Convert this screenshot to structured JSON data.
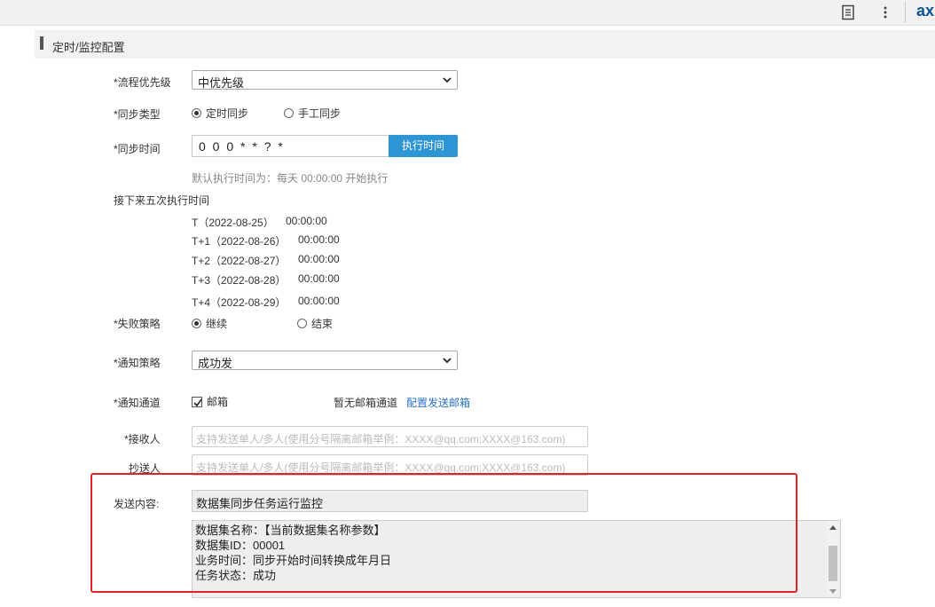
{
  "topbar": {
    "brand": "ax",
    "icons": [
      "document-icon",
      "more-vertical-icon"
    ]
  },
  "section": {
    "title": "定时/监控配置"
  },
  "form": {
    "priority": {
      "label": "*流程优先级",
      "value": "中优先级"
    },
    "sync_type": {
      "label": "*同步类型",
      "options": [
        "定时同步",
        "手工同步"
      ],
      "selected": "定时同步"
    },
    "sync_time": {
      "label": "*同步时间",
      "value": "0 0 0 * * ?  *",
      "button": "执行时间",
      "hint": "默认执行时间为：每天  00:00:00 开始执行"
    },
    "next_runs": {
      "label": "接下来五次执行时间",
      "rows": [
        {
          "day": "T（2022-08-25）",
          "time": "00:00:00"
        },
        {
          "day": "T+1（2022-08-26）",
          "time": "00:00:00"
        },
        {
          "day": "T+2（2022-08-27）",
          "time": "00:00:00"
        },
        {
          "day": "T+3（2022-08-28）",
          "time": "00:00:00"
        },
        {
          "day": "T+4（2022-08-29）",
          "time": "00:00:00"
        }
      ]
    },
    "fail_policy": {
      "label": "*失败策略",
      "options": [
        "继续",
        "结束"
      ],
      "selected": "继续"
    },
    "notify_policy": {
      "label": "*通知策略",
      "value": "成功发"
    },
    "notify_channel": {
      "label": "*通知通道",
      "checkbox": "邮箱",
      "checked": true,
      "no_channel": "暂无邮箱通道",
      "config_link": "配置发送邮箱"
    },
    "recipient": {
      "label": "*接收人",
      "placeholder": "支持发送单人/多人(使用分号隔离邮箱举例：XXXX@qq.com;XXXX@163.com)"
    },
    "cc": {
      "label": "抄送人",
      "placeholder": "支持发送单人/多人(使用分号隔离邮箱举例：XXXX@qq.com;XXXX@163.com)"
    },
    "content": {
      "label": "发送内容:",
      "subject": "数据集同步任务运行监控",
      "lines": [
        "数据集名称：【当前数据集名称参数】",
        "数据集ID：00001",
        "业务时间：同步开始时间转换成年月日",
        "任务状态：成功"
      ]
    }
  },
  "colors": {
    "accent": "#2d95d3",
    "link": "#2a72c8",
    "highlight": "#e02424"
  }
}
